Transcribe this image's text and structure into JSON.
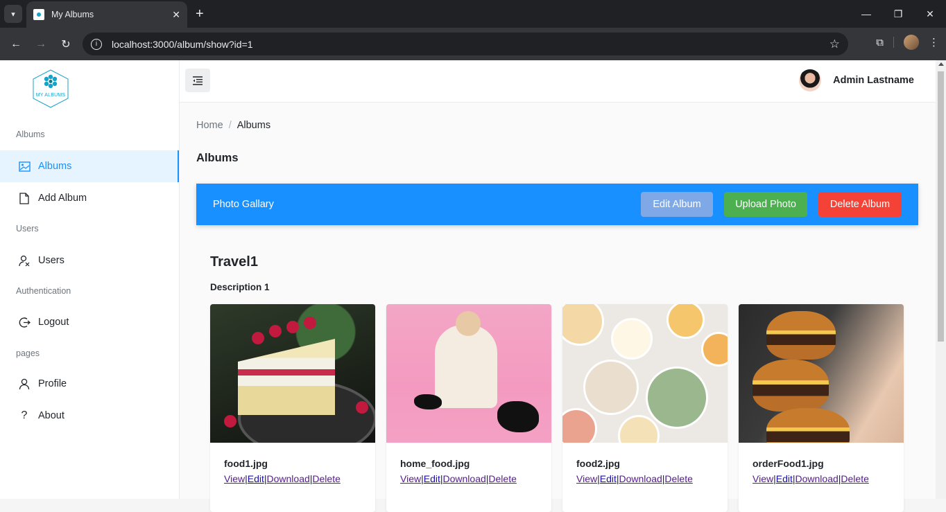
{
  "browser": {
    "tab_title": "My Albums",
    "url": "localhost:3000/album/show?id=1"
  },
  "sidebar": {
    "logo_text": "MY ALBUMS",
    "sections": [
      {
        "heading": "Albums",
        "items": [
          {
            "label": "Albums",
            "icon": "image-icon",
            "active": true
          },
          {
            "label": "Add Album",
            "icon": "file-icon",
            "active": false
          }
        ]
      },
      {
        "heading": "Users",
        "items": [
          {
            "label": "Users",
            "icon": "users-icon",
            "active": false
          }
        ]
      },
      {
        "heading": "Authentication",
        "items": [
          {
            "label": "Logout",
            "icon": "logout-icon",
            "active": false
          }
        ]
      },
      {
        "heading": "pages",
        "items": [
          {
            "label": "Profile",
            "icon": "user-icon",
            "active": false
          },
          {
            "label": "About",
            "icon": "question-icon",
            "active": false
          }
        ]
      }
    ]
  },
  "header": {
    "user_name": "Admin Lastname"
  },
  "breadcrumb": {
    "home": "Home",
    "separator": "/",
    "current": "Albums"
  },
  "page_title": "Albums",
  "banner": {
    "title": "Photo Gallary",
    "edit_label": "Edit Album",
    "upload_label": "Upload Photo",
    "delete_label": "Delete Album",
    "color": "#1890ff"
  },
  "album": {
    "name": "Travel1",
    "description": "Description 1"
  },
  "photos": [
    {
      "file": "food1.jpg",
      "view": "View",
      "edit": "Edit",
      "download": "Download",
      "delete": "Delete"
    },
    {
      "file": "home_food.jpg",
      "view": "View",
      "edit": "Edit",
      "download": "Download",
      "delete": "Delete"
    },
    {
      "file": "food2.jpg",
      "view": "View",
      "edit": "Edit",
      "download": "Download",
      "delete": "Delete"
    },
    {
      "file": "orderFood1.jpg",
      "view": "View",
      "edit": "Edit",
      "download": "Download",
      "delete": "Delete"
    }
  ]
}
